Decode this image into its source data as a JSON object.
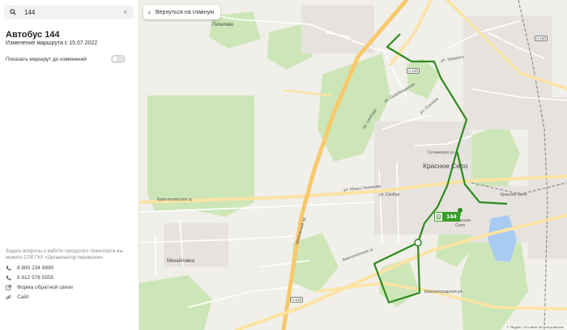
{
  "search": {
    "value": "144",
    "clear_icon": "×"
  },
  "route": {
    "title": "Автобус 144",
    "subtitle": "Изменение маршрута с 15.07.2022",
    "toggle_label": "Показать маршрут до изменений",
    "toggle_on": false
  },
  "contacts": {
    "intro": "Задать вопросы о работе городского транспорта вы можете СПб ГКУ «Организатор перевозок»",
    "phone1": "8 800 234 9890",
    "phone2": "8 812 576 5555",
    "feedback": "Форма обратной связи",
    "site": "Сайт"
  },
  "map": {
    "back_label": "Вернуться на главную",
    "accent": "#2e8b1e",
    "places": {
      "krasnoe_selo": "Красное Село",
      "mikhailovka": "Михайловка",
      "pigelevo": "Пигелево",
      "station": "Красное Село",
      "stop": "Красное Село"
    },
    "streets": {
      "kingiseppskoe": "Кингисеппское ш.",
      "krasnogorodskaya": "Красногородская ул.",
      "krasnoselskoe": "Красносельское ш.",
      "gatchinskaya": "Гатчинская ул.",
      "yuny_pionerov": "ул. Юных Пионеров",
      "skobory": "ул. Скобор",
      "ivanovskoe": "Ивановский пр.",
      "svobody": "пр. Свободы",
      "osvobozhdeniya": "ул. Освобождения",
      "sokolov": "ул. Соколов",
      "uritskogo": "ул. Урицкого"
    },
    "road_shields": [
      "А-120",
      "А-120",
      "А-180"
    ],
    "bus_number": "144",
    "copyright": "© Яндекс   Условия использования"
  }
}
